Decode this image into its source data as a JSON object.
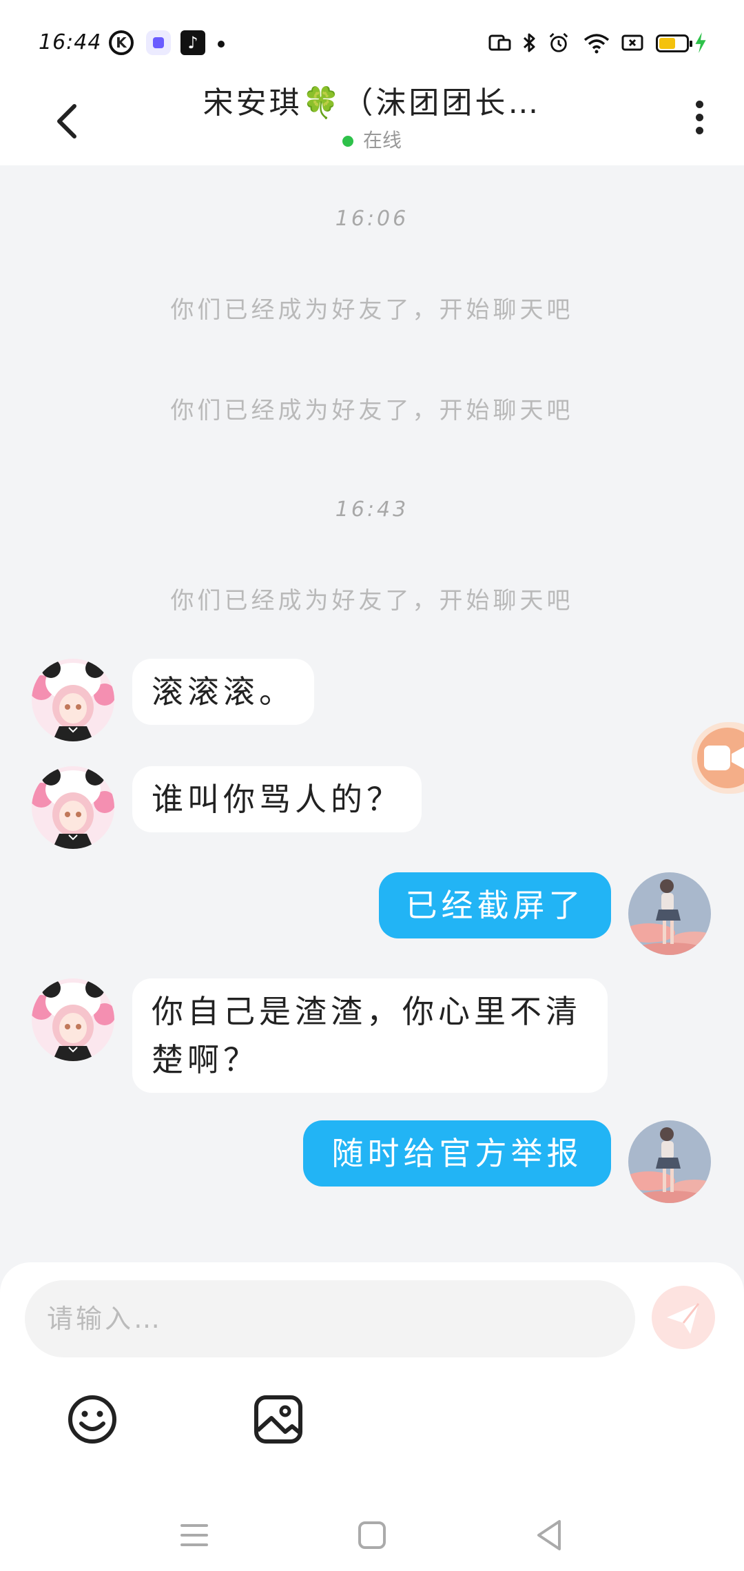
{
  "status_bar": {
    "time": "16:44",
    "left_icons": [
      "kuaishou-k-icon",
      "purple-app-icon",
      "tiktok-icon",
      "notification-dot"
    ],
    "right_icons": [
      "screen-cast-icon",
      "bluetooth-icon",
      "alarm-icon",
      "wifi-icon",
      "sim-icon",
      "battery-icon",
      "charging-icon"
    ],
    "battery_level": 0.6,
    "battery_color": "#f4c20d",
    "charging_color": "#2ec14a"
  },
  "header": {
    "title": "宋安琪🍀（沫团团长…",
    "status": "在线",
    "status_color": "#2ec14a",
    "back_icon": "chevron-left-icon",
    "more_icon": "more-vertical-icon"
  },
  "chat": {
    "timestamps": [
      "16:06",
      "16:43"
    ],
    "system_messages": [
      "你们已经成为好友了，开始聊天吧",
      "你们已经成为好友了，开始聊天吧",
      "你们已经成为好友了，开始聊天吧"
    ],
    "messages": [
      {
        "side": "left",
        "text": "滚滚滚。"
      },
      {
        "side": "left",
        "text": "谁叫你骂人的？"
      },
      {
        "side": "right",
        "text": "已经截屏了"
      },
      {
        "side": "left",
        "line1": "你自己是渣渣，你心里不清",
        "line2": "楚啊？"
      },
      {
        "side": "right",
        "text": "随时给官方举报"
      }
    ],
    "bubble_colors": {
      "incoming": "#ffffff",
      "outgoing": "#22b4f5"
    },
    "floating_button_icon": "video-call-icon"
  },
  "input": {
    "placeholder": "请输入…",
    "send_icon": "send-icon",
    "tools": [
      "emoji-icon",
      "image-icon"
    ]
  },
  "navbar": {
    "buttons": [
      "menu-icon",
      "home-icon",
      "back-triangle-icon"
    ]
  }
}
